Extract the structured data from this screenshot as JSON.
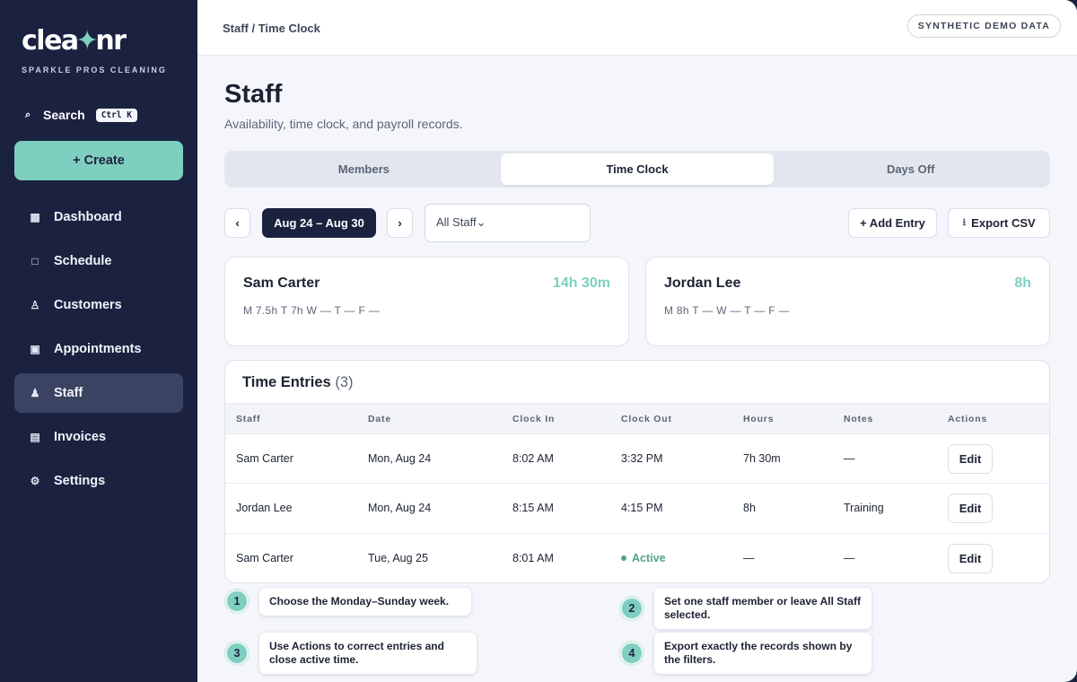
{
  "brand": {
    "logo_left": "clea",
    "logo_spark": "✦",
    "logo_right": "nr",
    "tagline": "SPARKLE PROS CLEANING"
  },
  "sidebar": {
    "search_label": "Search",
    "search_shortcut": "Ctrl K",
    "create_label": "+ Create",
    "items": [
      {
        "label": "Dashboard",
        "icon": "grid-icon",
        "glyph": "▦"
      },
      {
        "label": "Schedule",
        "icon": "calendar-icon",
        "glyph": "□"
      },
      {
        "label": "Customers",
        "icon": "person-icon",
        "glyph": "♙"
      },
      {
        "label": "Appointments",
        "icon": "appointment-icon",
        "glyph": "▣"
      },
      {
        "label": "Staff",
        "icon": "staff-icon",
        "glyph": "♟"
      },
      {
        "label": "Invoices",
        "icon": "invoice-icon",
        "glyph": "▤"
      },
      {
        "label": "Settings",
        "icon": "gear-icon",
        "glyph": "⚙"
      }
    ],
    "active_item": "Staff"
  },
  "topbar": {
    "breadcrumb": "Staff / Time Clock",
    "badge": "SYNTHETIC DEMO DATA"
  },
  "page": {
    "title": "Staff",
    "subtitle": "Availability, time clock, and payroll records."
  },
  "tabs": [
    {
      "label": "Members"
    },
    {
      "label": "Time Clock"
    },
    {
      "label": "Days Off"
    }
  ],
  "active_tab": "Time Clock",
  "toolbar": {
    "prev": "‹",
    "next": "›",
    "week_range": "Aug 24 – Aug 30",
    "staff_filter": "All Staff",
    "staff_filter_caret": "⌄",
    "add_entry": "+ Add Entry",
    "export_icon": "⭳",
    "export_csv": "Export CSV"
  },
  "summary_cards": [
    {
      "name": "Sam Carter",
      "total": "14h 30m",
      "days": "M 7.5h  T 7h  W —  T —  F —"
    },
    {
      "name": "Jordan Lee",
      "total": "8h",
      "days": "M 8h  T —  W —  T —  F —"
    }
  ],
  "entries": {
    "title": "Time Entries",
    "count": "(3)",
    "columns": [
      "Staff",
      "Date",
      "Clock In",
      "Clock Out",
      "Hours",
      "Notes",
      "Actions"
    ],
    "rows": [
      {
        "staff": "Sam Carter",
        "date": "Mon, Aug 24",
        "clock_in": "8:02 AM",
        "clock_out": "3:32 PM",
        "hours": "7h 30m",
        "notes": "—",
        "action": "Edit"
      },
      {
        "staff": "Jordan Lee",
        "date": "Mon, Aug 24",
        "clock_in": "8:15 AM",
        "clock_out": "4:15 PM",
        "hours": "8h",
        "notes": "Training",
        "action": "Edit"
      },
      {
        "staff": "Sam Carter",
        "date": "Tue, Aug 25",
        "clock_in": "8:01 AM",
        "clock_out": "Active",
        "hours": "—",
        "notes": "—",
        "action": "Edit"
      }
    ]
  },
  "callouts": [
    {
      "num": "1",
      "text": "Choose the Monday–Sunday week."
    },
    {
      "num": "2",
      "text": "Set one staff member or leave All Staff selected."
    },
    {
      "num": "3",
      "text": "Use Actions to correct entries and close active time."
    },
    {
      "num": "4",
      "text": "Export exactly the records shown by the filters."
    }
  ],
  "colors": {
    "sidebar_bg": "#1b2240",
    "accent": "#7fcfc0",
    "active_status": "#4fa389",
    "page_bg": "#f4f6fb"
  }
}
